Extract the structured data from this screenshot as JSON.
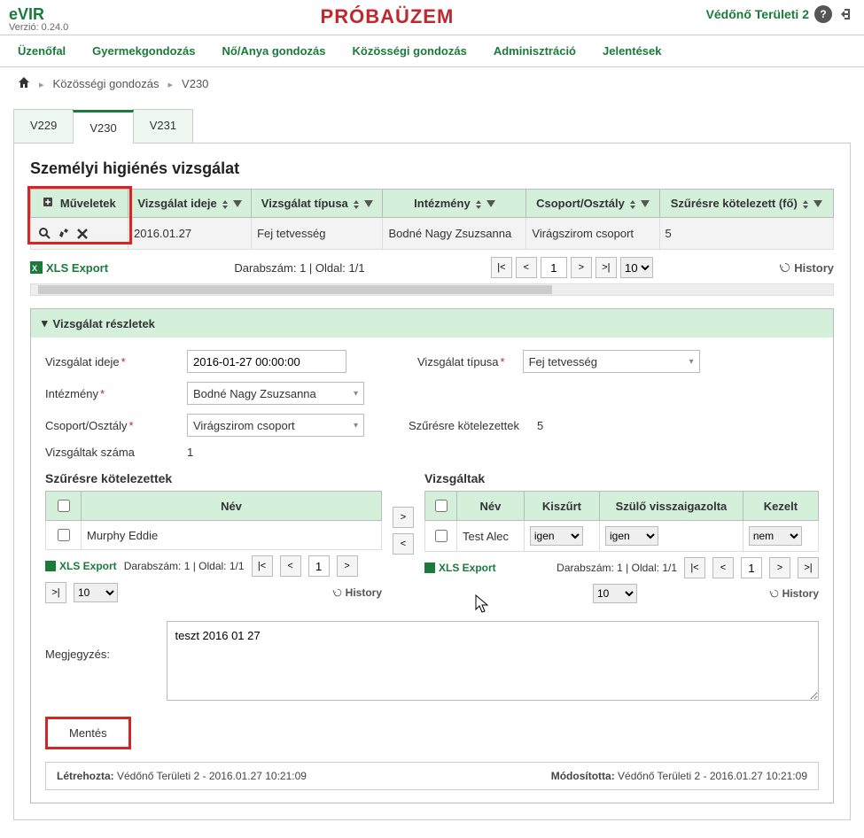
{
  "app": {
    "name": "eVIR",
    "version": "Verzió: 0.24.0",
    "banner": "PRÓBAÜZEM",
    "user": "Védőnő Területi 2"
  },
  "nav": {
    "items": [
      "Üzenőfal",
      "Gyermekgondozás",
      "Nő/Anya gondozás",
      "Közösségi gondozás",
      "Adminisztráció",
      "Jelentések"
    ]
  },
  "crumbs": {
    "a": "Közösségi gondozás",
    "b": "V230"
  },
  "tabs": {
    "t0": "V229",
    "t1": "V230",
    "t2": "V231"
  },
  "page": {
    "title": "Személyi higiénés vizsgálat",
    "cols": {
      "ops": "Műveletek",
      "time": "Vizsgálat ideje",
      "type": "Vizsgálat típusa",
      "inst": "Intézmény",
      "grp": "Csoport/Osztály",
      "req": "Szűrésre kötelezett (fő)"
    },
    "row": {
      "time": "2016.01.27",
      "type": "Fej tetvesség",
      "inst": "Bodné Nagy Zsuzsanna",
      "grp": "Virágszirom csoport",
      "req": "5"
    },
    "xls": "XLS Export",
    "count": "Darabszám: 1 | Oldal: 1/1",
    "pgnum": "1",
    "pgsize": "10",
    "history": "History"
  },
  "details": {
    "header": "Vizsgálat részletek",
    "labels": {
      "time": "Vizsgálat ideje",
      "type": "Vizsgálat típusa",
      "inst": "Intézmény",
      "grp": "Csoport/Osztály",
      "req": "Szűrésre kötelezettek",
      "count": "Vizsgáltak száma",
      "notes": "Megjegyzés:"
    },
    "values": {
      "time": "2016-01-27 00:00:00",
      "type": "Fej tetvesség",
      "inst": "Bodné Nagy Zsuzsanna",
      "grp": "Virágszirom csoport",
      "req": "5",
      "count": "1"
    },
    "left": {
      "title": "Szűrésre kötelezettek",
      "colname": "Név",
      "row": "Murphy Eddie",
      "count": "Darabszám: 1 | Oldal: 1/1",
      "pgnum": "1",
      "pgsize": "10"
    },
    "right": {
      "title": "Vizsgáltak",
      "cname": "Név",
      "cfilt": "Kiszűrt",
      "cpar": "Szülő visszaigazolta",
      "ctrt": "Kezelt",
      "row_name": "Test Alec",
      "v_filt": "igen",
      "v_par": "igen",
      "v_trt": "nem",
      "count": "Darabszám: 1 | Oldal: 1/1",
      "pgnum": "1",
      "pgsize": "10"
    },
    "note_text": "teszt 2016 01 27",
    "save": "Mentés"
  },
  "audit": {
    "created_l": "Létrehozta:",
    "created_v": " Védőnő Területi 2 - 2016.01.27 10:21:09",
    "mod_l": "Módosította:",
    "mod_v": " Védőnő Területi 2 - 2016.01.27 10:21:09"
  }
}
